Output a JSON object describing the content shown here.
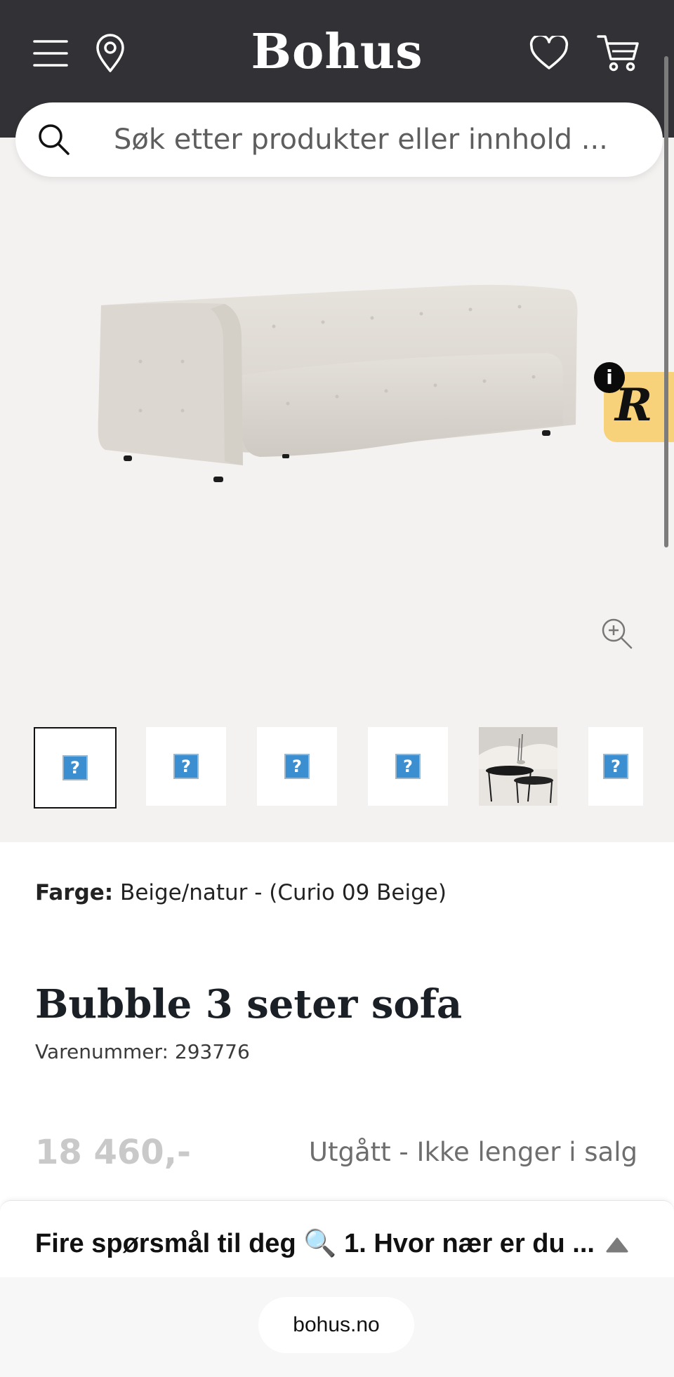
{
  "header": {
    "brand": "Bohus",
    "search_placeholder": "Søk etter produkter eller innhold ..."
  },
  "gallery": {
    "badge_letter": "R",
    "info_letter": "i",
    "thumbnails": [
      {
        "kind": "placeholder",
        "glyph": "?",
        "selected": true
      },
      {
        "kind": "placeholder",
        "glyph": "?",
        "selected": false
      },
      {
        "kind": "placeholder",
        "glyph": "?",
        "selected": false
      },
      {
        "kind": "placeholder",
        "glyph": "?",
        "selected": false
      },
      {
        "kind": "photo",
        "subject": "coffee tables"
      },
      {
        "kind": "placeholder",
        "glyph": "?",
        "selected": false
      }
    ]
  },
  "product": {
    "color_label": "Farge:",
    "color_value": "Beige/natur - (Curio 09 Beige)",
    "title": "Bubble 3 seter sofa",
    "sku_text": "Varenummer: 293776",
    "price": "18 460,-",
    "status": "Utgått - Ikke lenger i salg"
  },
  "survey": {
    "text": "Fire spørsmål til deg 🔍 1. Hvor nær er du ..."
  },
  "browser": {
    "url": "bohus.no"
  },
  "colors": {
    "header_bg": "#323135",
    "gallery_bg": "#f4f2f1",
    "badge_bg": "#f7d27a",
    "price_muted": "#c9c9c9"
  }
}
